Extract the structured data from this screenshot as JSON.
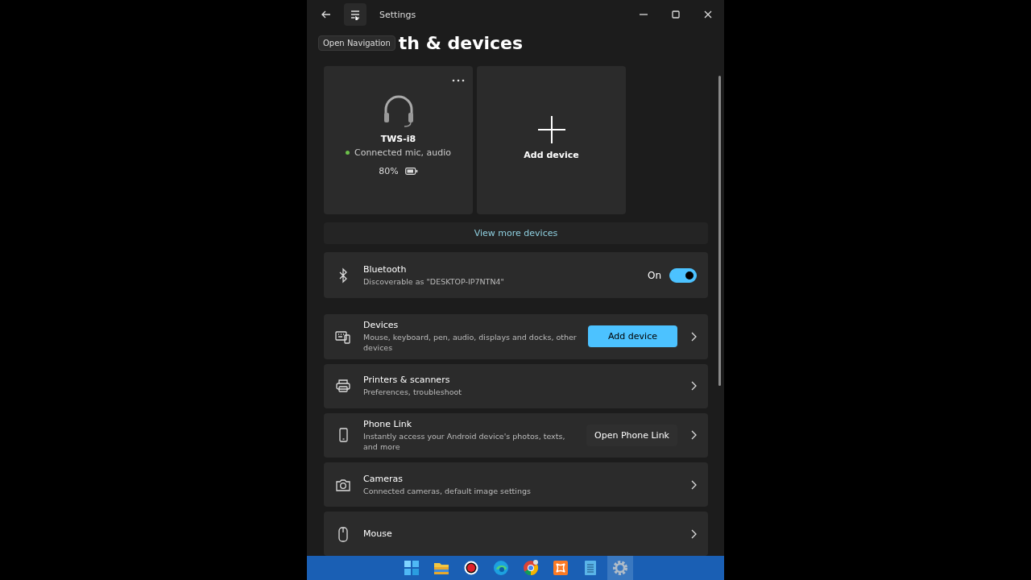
{
  "window": {
    "title": "Settings"
  },
  "tooltip": "Open Navigation",
  "heading": "th & devices",
  "device_cards": [
    {
      "kind": "device",
      "name": "TWS-i8",
      "status": "Connected mic, audio",
      "battery": "80%"
    },
    {
      "kind": "add",
      "label": "Add device"
    }
  ],
  "view_more": "View more devices",
  "bluetooth": {
    "title": "Bluetooth",
    "subtitle": "Discoverable as \"DESKTOP-IP7NTN4\"",
    "state_label": "On",
    "on": true
  },
  "settings_rows": [
    {
      "title": "Devices",
      "subtitle": "Mouse, keyboard, pen, audio, displays and docks, other devices",
      "button": {
        "label": "Add device",
        "primary": true
      }
    },
    {
      "title": "Printers & scanners",
      "subtitle": "Preferences, troubleshoot"
    },
    {
      "title": "Phone Link",
      "subtitle": "Instantly access your Android device's photos, texts, and more",
      "button": {
        "label": "Open Phone Link",
        "primary": false
      }
    },
    {
      "title": "Cameras",
      "subtitle": "Connected cameras, default image settings"
    },
    {
      "title": "Mouse"
    }
  ],
  "taskbar": {
    "items": [
      {
        "selected": false
      },
      {
        "selected": false
      },
      {
        "selected": false
      },
      {
        "selected": false
      },
      {
        "selected": false
      },
      {
        "selected": false
      },
      {
        "selected": false
      },
      {
        "selected": true
      }
    ]
  }
}
